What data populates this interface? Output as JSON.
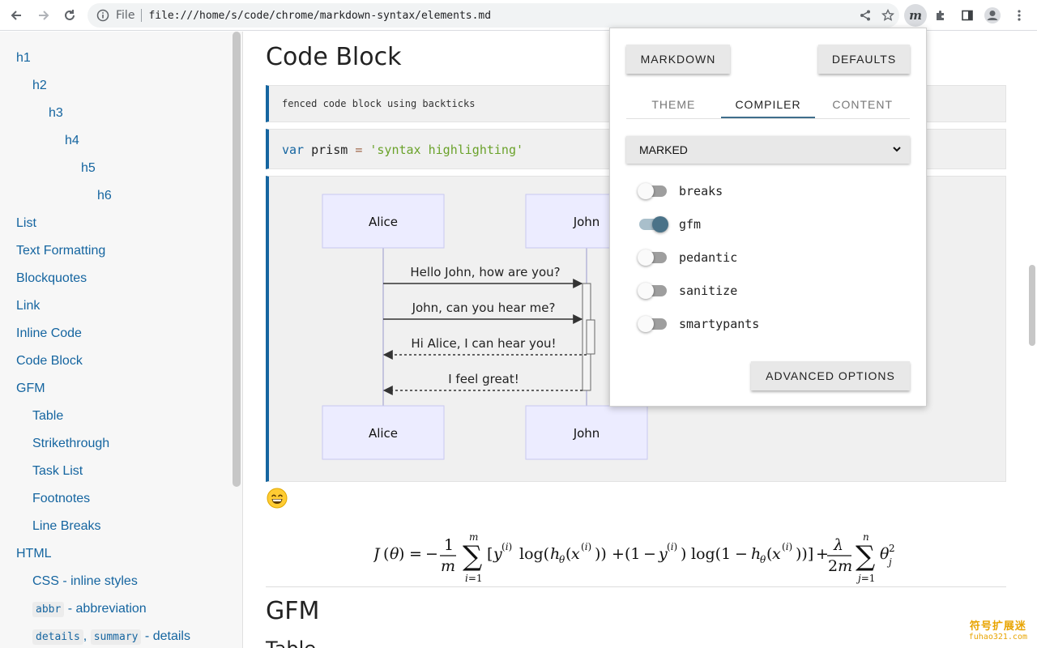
{
  "browser": {
    "scheme_label": "File",
    "url": "file:///home/s/code/chrome/markdown-syntax/elements.md"
  },
  "toc": {
    "items": [
      {
        "label": "h1"
      },
      {
        "label": "h2"
      },
      {
        "label": "h3"
      },
      {
        "label": "h4"
      },
      {
        "label": "h5"
      },
      {
        "label": "h6"
      },
      {
        "label": "List"
      },
      {
        "label": "Text Formatting"
      },
      {
        "label": "Blockquotes"
      },
      {
        "label": "Link"
      },
      {
        "label": "Inline Code"
      },
      {
        "label": "Code Block"
      },
      {
        "label": "GFM"
      },
      {
        "label": "Table"
      },
      {
        "label": "Strikethrough"
      },
      {
        "label": "Task List"
      },
      {
        "label": "Footnotes"
      },
      {
        "label": "Line Breaks"
      },
      {
        "label": "HTML"
      },
      {
        "label": "CSS - inline styles"
      }
    ],
    "abbr_item": {
      "code": "abbr",
      "text": " - abbreviation"
    },
    "details_item": {
      "code1": "details",
      "sep": ", ",
      "code2": "summary",
      "text": " - details"
    }
  },
  "content": {
    "heading_code_block": "Code Block",
    "fenced_code": "fenced code block using backticks",
    "prism_line": {
      "kw": "var",
      "id": "prism",
      "op": "=",
      "str": "'syntax highlighting'"
    },
    "diagram": {
      "actor_left": "Alice",
      "actor_right": "John",
      "messages": [
        "Hello John, how are you?",
        "John, can you hear me?",
        "Hi Alice, I can hear you!",
        "I feel great!"
      ]
    },
    "heading_gfm": "GFM",
    "heading_table": "Table"
  },
  "popup": {
    "markdown_button": "MARKDOWN",
    "defaults_button": "DEFAULTS",
    "tabs": [
      "THEME",
      "COMPILER",
      "CONTENT"
    ],
    "active_tab": "COMPILER",
    "compiler_select": "MARKED",
    "options": [
      {
        "label": "breaks",
        "on": false
      },
      {
        "label": "gfm",
        "on": true
      },
      {
        "label": "pedantic",
        "on": false
      },
      {
        "label": "sanitize",
        "on": false
      },
      {
        "label": "smartypants",
        "on": false
      }
    ],
    "advanced_button": "ADVANCED OPTIONS"
  },
  "watermark": {
    "line1": "符号扩展迷",
    "line2": "fuhao321.com"
  },
  "colors": {
    "accent": "#1565a0",
    "toggle_on": "#4a7288",
    "diagram_actor_fill": "#ececff",
    "diagram_actor_border": "#c9c9f0"
  }
}
